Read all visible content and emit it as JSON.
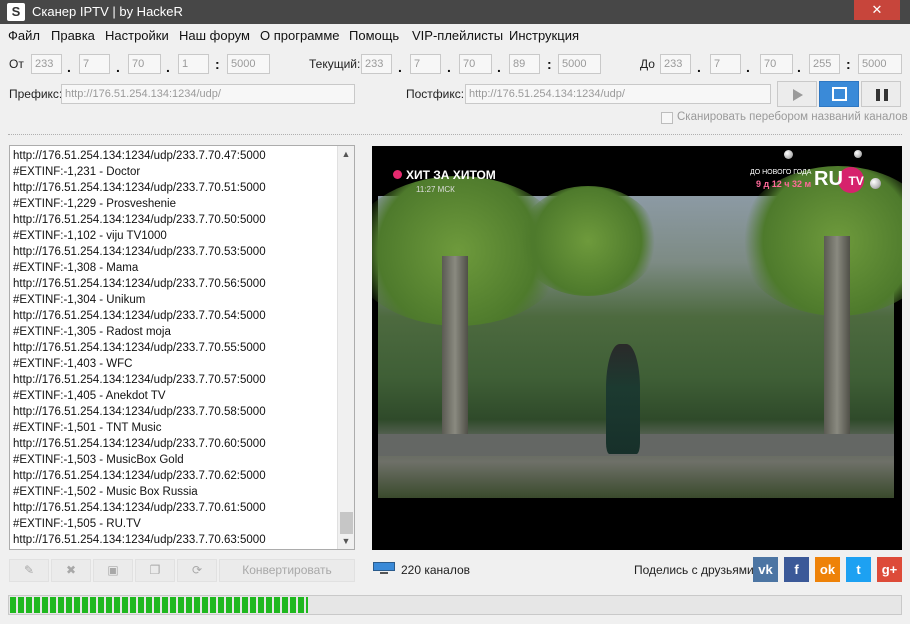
{
  "window": {
    "title": "Сканер IPTV | by HackeR",
    "icon_char": "S",
    "close_glyph": "✕"
  },
  "menu": [
    "Файл",
    "Правка",
    "Настройки",
    "Наш форум",
    "О программе",
    "Помощь",
    "VIP-плейлисты",
    "Инструкция"
  ],
  "range": {
    "from_label": "От",
    "from": [
      "233",
      "7",
      "70",
      "1",
      "5000"
    ],
    "current_label": "Текущий:",
    "current": [
      "233",
      "7",
      "70",
      "89",
      "5000"
    ],
    "to_label": "До",
    "to": [
      "233",
      "7",
      "70",
      "255",
      "5000"
    ],
    "dot": ".",
    "colon": ":"
  },
  "prefix": {
    "label": "Префикс:",
    "value": "http://176.51.254.134:1234/udp/"
  },
  "postfix": {
    "label": "Постфикс:",
    "value": "http://176.51.254.134:1234/udp/"
  },
  "scan_names_option": {
    "label": "Сканировать перебором названий каналов",
    "checked": false
  },
  "playlist_lines": [
    "http://176.51.254.134:1234/udp/233.7.70.47:5000",
    "#EXTINF:-1,231 - Doctor",
    "http://176.51.254.134:1234/udp/233.7.70.51:5000",
    "#EXTINF:-1,229 - Prosveshenie",
    "http://176.51.254.134:1234/udp/233.7.70.50:5000",
    "#EXTINF:-1,102 - viju TV1000",
    "http://176.51.254.134:1234/udp/233.7.70.53:5000",
    "#EXTINF:-1,308 - Mama",
    "http://176.51.254.134:1234/udp/233.7.70.56:5000",
    "#EXTINF:-1,304 - Unikum",
    "http://176.51.254.134:1234/udp/233.7.70.54:5000",
    "#EXTINF:-1,305 - Radost moja",
    "http://176.51.254.134:1234/udp/233.7.70.55:5000",
    "#EXTINF:-1,403 - WFC",
    "http://176.51.254.134:1234/udp/233.7.70.57:5000",
    "#EXTINF:-1,405 - Anekdot TV",
    "http://176.51.254.134:1234/udp/233.7.70.58:5000",
    "#EXTINF:-1,501 - TNT Music",
    "http://176.51.254.134:1234/udp/233.7.70.60:5000",
    "#EXTINF:-1,503 - MusicBox Gold",
    "http://176.51.254.134:1234/udp/233.7.70.62:5000",
    "#EXTINF:-1,502 - Music Box Russia",
    "http://176.51.254.134:1234/udp/233.7.70.61:5000",
    "#EXTINF:-1,505 - RU.TV",
    "http://176.51.254.134:1234/udp/233.7.70.63:5000"
  ],
  "player": {
    "channel_logo": "ХИТ ЗА ХИТОМ",
    "time": "11:27 МСК",
    "ny_label": "ДО НОВОГО ГОДА",
    "ny_counter": "9 д  12 ч  32 м",
    "brand_ru": "RU",
    "brand_tv": "TV"
  },
  "toolbar": {
    "icons": [
      "pencil-icon",
      "delete-icon",
      "save-icon",
      "copy-icon",
      "refresh-icon"
    ],
    "glyphs": [
      "✎",
      "✖",
      "▣",
      "❐",
      "⟳"
    ],
    "convert_label": "Конвертировать"
  },
  "channels_count": "220 каналов",
  "share": {
    "label": "Поделись с друзьями:",
    "buttons": [
      {
        "name": "vk",
        "glyph": "vk",
        "color": "#4c75a3"
      },
      {
        "name": "facebook",
        "glyph": "f",
        "color": "#3b5998"
      },
      {
        "name": "odnoklassniki",
        "glyph": "ok",
        "color": "#ee8208"
      },
      {
        "name": "twitter",
        "glyph": "t",
        "color": "#1da1f2"
      },
      {
        "name": "google-plus",
        "glyph": "g+",
        "color": "#dd4b39"
      }
    ]
  },
  "controls": {
    "play_glyph": "▶",
    "stop_glyph": "■",
    "pause_glyph": "❚❚"
  },
  "scan_progress": 0.335,
  "colors": {
    "accent": "#3a8ad8",
    "progress": "#1fb81f"
  }
}
